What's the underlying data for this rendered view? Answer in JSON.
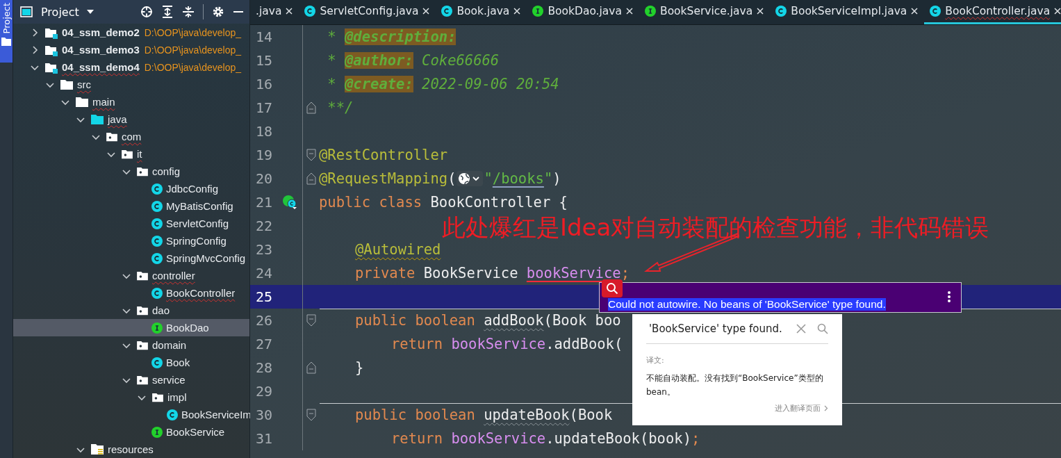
{
  "side_strip": {
    "label": "Project"
  },
  "project": {
    "title": "Project",
    "tree": [
      {
        "name": "04_ssm_demo2",
        "path": "D:\\OOP\\java\\develop_",
        "kind": "module",
        "expanded": false,
        "selected": false,
        "flagged": false
      },
      {
        "name": "04_ssm_demo3",
        "path": "D:\\OOP\\java\\develop_",
        "kind": "module",
        "expanded": false,
        "selected": false,
        "flagged": false
      },
      {
        "name": "04_ssm_demo4",
        "path": "D:\\OOP\\java\\develop_",
        "kind": "module",
        "expanded": true,
        "selected": false,
        "flagged": true,
        "children": [
          {
            "name": "src",
            "kind": "folder",
            "expanded": true,
            "selected": false,
            "flagged": true,
            "children": [
              {
                "name": "main",
                "kind": "folder",
                "expanded": true,
                "selected": false,
                "flagged": true,
                "children": [
                  {
                    "name": "java",
                    "kind": "source",
                    "expanded": true,
                    "selected": false,
                    "flagged": true,
                    "children": [
                      {
                        "name": "com",
                        "kind": "package",
                        "expanded": true,
                        "selected": false,
                        "flagged": true,
                        "children": [
                          {
                            "name": "it",
                            "kind": "package",
                            "expanded": true,
                            "selected": false,
                            "flagged": true,
                            "children": [
                              {
                                "name": "config",
                                "kind": "package",
                                "expanded": true,
                                "selected": false,
                                "flagged": false,
                                "children": [
                                  {
                                    "name": "JdbcConfig",
                                    "kind": "class",
                                    "selected": false,
                                    "flagged": false
                                  },
                                  {
                                    "name": "MyBatisConfig",
                                    "kind": "class",
                                    "selected": false,
                                    "flagged": false
                                  },
                                  {
                                    "name": "ServletConfig",
                                    "kind": "class",
                                    "selected": false,
                                    "flagged": false
                                  },
                                  {
                                    "name": "SpringConfig",
                                    "kind": "class",
                                    "selected": false,
                                    "flagged": false
                                  },
                                  {
                                    "name": "SpringMvcConfig",
                                    "kind": "class",
                                    "selected": false,
                                    "flagged": false
                                  }
                                ]
                              },
                              {
                                "name": "controller",
                                "kind": "package",
                                "expanded": true,
                                "selected": false,
                                "flagged": true,
                                "children": [
                                  {
                                    "name": "BookController",
                                    "kind": "class",
                                    "selected": false,
                                    "flagged": true
                                  }
                                ]
                              },
                              {
                                "name": "dao",
                                "kind": "package",
                                "expanded": true,
                                "selected": false,
                                "flagged": false,
                                "children": [
                                  {
                                    "name": "BookDao",
                                    "kind": "interface",
                                    "selected": true,
                                    "flagged": false
                                  }
                                ]
                              },
                              {
                                "name": "domain",
                                "kind": "package",
                                "expanded": true,
                                "selected": false,
                                "flagged": false,
                                "children": [
                                  {
                                    "name": "Book",
                                    "kind": "class",
                                    "selected": false,
                                    "flagged": false
                                  }
                                ]
                              },
                              {
                                "name": "service",
                                "kind": "package",
                                "expanded": true,
                                "selected": false,
                                "flagged": false,
                                "children": [
                                  {
                                    "name": "impl",
                                    "kind": "package",
                                    "expanded": true,
                                    "selected": false,
                                    "flagged": false,
                                    "children": [
                                      {
                                        "name": "BookServiceIm",
                                        "kind": "class",
                                        "selected": false,
                                        "flagged": false
                                      }
                                    ]
                                  },
                                  {
                                    "name": "BookService",
                                    "kind": "interface",
                                    "selected": false,
                                    "flagged": false
                                  }
                                ]
                              }
                            ]
                          }
                        ]
                      }
                    ]
                  },
                  {
                    "name": "resources",
                    "kind": "resources",
                    "expanded": true,
                    "selected": false,
                    "flagged": false
                  }
                ]
              }
            ]
          }
        ]
      }
    ]
  },
  "tabs": [
    {
      "label": ".java",
      "kind": "none",
      "selected": false,
      "flagged": false
    },
    {
      "label": "ServletConfig.java",
      "kind": "class",
      "selected": false,
      "flagged": false
    },
    {
      "label": "Book.java",
      "kind": "class",
      "selected": false,
      "flagged": false
    },
    {
      "label": "BookDao.java",
      "kind": "interface",
      "selected": false,
      "flagged": false
    },
    {
      "label": "BookService.java",
      "kind": "interface",
      "selected": false,
      "flagged": false
    },
    {
      "label": "BookServiceImpl.java",
      "kind": "class",
      "selected": false,
      "flagged": false
    },
    {
      "label": "BookController.java",
      "kind": "class",
      "selected": true,
      "flagged": true
    }
  ],
  "code": [
    {
      "number": "14",
      "kind": "top",
      "fold_start": false,
      "fold_end": false,
      "current": false,
      "separator": false,
      "tokens": [
        {
          "kind": "comment",
          "text": " * "
        },
        {
          "kind": "doctag",
          "text": "@description:"
        }
      ]
    },
    {
      "number": "15",
      "kind": "top",
      "fold_start": false,
      "fold_end": false,
      "current": false,
      "separator": false,
      "tokens": [
        {
          "kind": "comment",
          "text": " * "
        },
        {
          "kind": "doctag",
          "text": "@author:"
        },
        {
          "kind": "comment",
          "text": " Coke66666"
        }
      ]
    },
    {
      "number": "16",
      "kind": "top",
      "fold_start": false,
      "fold_end": false,
      "current": false,
      "separator": false,
      "tokens": [
        {
          "kind": "comment",
          "text": " * "
        },
        {
          "kind": "doctag",
          "text": "@create:"
        },
        {
          "kind": "comment",
          "text": " 2022-09-06 20:54"
        }
      ]
    },
    {
      "number": "17",
      "kind": "top",
      "fold_start": false,
      "fold_end": true,
      "current": false,
      "separator": false,
      "tokens": [
        {
          "kind": "comment",
          "text": " **/"
        }
      ]
    },
    {
      "number": "18",
      "fold_start": false,
      "fold_end": false,
      "current": false,
      "separator": false
    },
    {
      "number": "19",
      "kind": "top",
      "fold_start": true,
      "fold_end": false,
      "current": false,
      "separator": false,
      "tokens": [
        {
          "kind": "annotation",
          "text": "@RestController"
        }
      ]
    },
    {
      "number": "20",
      "kind": "top",
      "fold_start": false,
      "fold_end": true,
      "current": false,
      "separator": false,
      "tokens": [
        {
          "kind": "annotation",
          "text": "@RequestMapping"
        },
        {
          "kind": "plain",
          "text": "("
        },
        {
          "kind": "globe"
        },
        {
          "kind": "string",
          "text": "\""
        },
        {
          "kind": "link",
          "text": "/books"
        },
        {
          "kind": "string",
          "text": "\""
        },
        {
          "kind": "plain",
          "text": ")"
        }
      ]
    },
    {
      "number": "21",
      "kind": "top",
      "fold_start": false,
      "fold_end": false,
      "bean_marker": true,
      "current": false,
      "separator": false,
      "tokens": [
        {
          "kind": "keyword",
          "text": "public class "
        },
        {
          "kind": "plain",
          "text": "BookController {"
        }
      ]
    },
    {
      "number": "22",
      "fold_start": false,
      "fold_end": false,
      "current": false,
      "separator": false
    },
    {
      "number": "23",
      "kind": "member",
      "fold_start": false,
      "fold_end": false,
      "current": false,
      "separator": false,
      "tokens": [
        {
          "kind": "annotation-warn",
          "text": "@Autowired"
        }
      ]
    },
    {
      "number": "24",
      "kind": "member",
      "fold_start": false,
      "fold_end": false,
      "current": false,
      "separator": false,
      "tokens": [
        {
          "kind": "keyword",
          "text": "private "
        },
        {
          "kind": "plain",
          "text": "BookService "
        },
        {
          "kind": "field-error",
          "text": "bookService"
        },
        {
          "kind": "keyword",
          "text": ";"
        }
      ]
    },
    {
      "number": "25",
      "fold_start": false,
      "fold_end": false,
      "current": true,
      "separator": false
    },
    {
      "number": "26",
      "kind": "member",
      "fold_start": true,
      "fold_end": false,
      "current": false,
      "separator": true,
      "tokens": [
        {
          "kind": "keyword",
          "text": "public boolean "
        },
        {
          "kind": "method",
          "text": "addBook"
        },
        {
          "kind": "plain",
          "text": "(Book boo"
        }
      ]
    },
    {
      "number": "27",
      "kind": "body",
      "fold_start": false,
      "fold_end": false,
      "current": false,
      "separator": false,
      "tokens": [
        {
          "kind": "keyword",
          "text": "return "
        },
        {
          "kind": "field",
          "text": "bookService"
        },
        {
          "kind": "plain",
          "text": ".addBook("
        }
      ]
    },
    {
      "number": "28",
      "kind": "member",
      "fold_start": false,
      "fold_end": true,
      "current": false,
      "separator": false,
      "tokens": [
        {
          "kind": "plain",
          "text": "}"
        }
      ]
    },
    {
      "number": "29",
      "fold_start": false,
      "fold_end": false,
      "current": false,
      "separator": false
    },
    {
      "number": "30",
      "kind": "member",
      "fold_start": true,
      "fold_end": false,
      "current": false,
      "separator": true,
      "tokens": [
        {
          "kind": "keyword",
          "text": "public boolean "
        },
        {
          "kind": "method",
          "text": "updateBook"
        },
        {
          "kind": "plain",
          "text": "(Book "
        }
      ]
    },
    {
      "number": "31",
      "kind": "body",
      "fold_start": false,
      "fold_end": false,
      "current": false,
      "separator": false,
      "tokens": [
        {
          "kind": "keyword",
          "text": "return "
        },
        {
          "kind": "field",
          "text": "bookService"
        },
        {
          "kind": "plain",
          "text": ".updateBook(book)"
        },
        {
          "kind": "keyword",
          "text": ";"
        }
      ]
    }
  ],
  "annotation": {
    "text": "此处爆红是Idea对自动装配的检查功能，非代码错误"
  },
  "error_tooltip": {
    "message": "Could not autowire. No beans of 'BookService' type found."
  },
  "translation_popup": {
    "query": "'BookService' type found.",
    "label": "译文:",
    "translation": "不能自动装配。没有找到“BookService”类型的bean。",
    "link": "进入翻译页面"
  }
}
